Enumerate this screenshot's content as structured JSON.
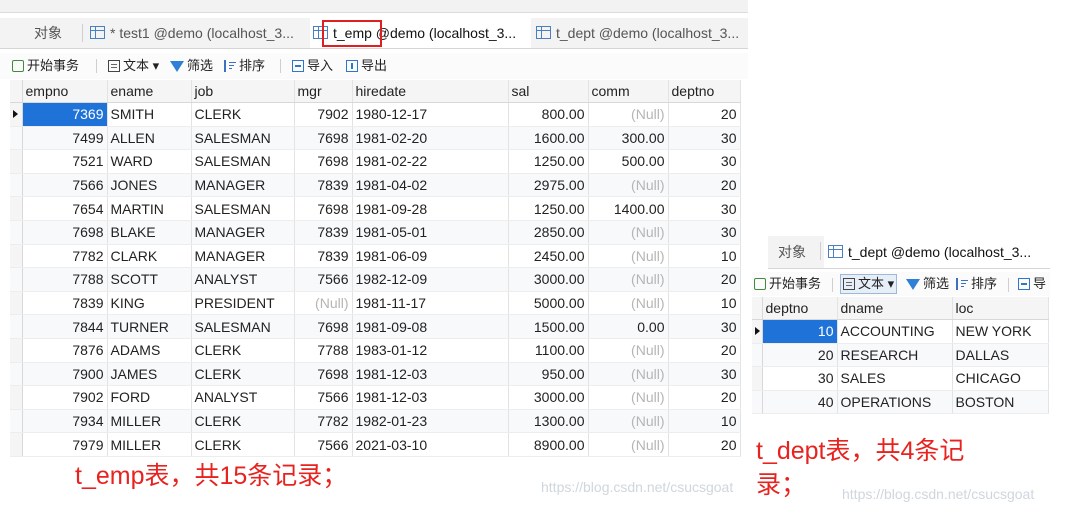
{
  "emp_window": {
    "tabs": [
      {
        "label": "对象"
      },
      {
        "label": "* test1 @demo (localhost_3..."
      },
      {
        "label": "t_emp @demo (localhost_3..."
      },
      {
        "label": "t_dept @demo (localhost_3..."
      }
    ],
    "toolbar": {
      "begin_tx": "开始事务",
      "text": "文本",
      "filter": "筛选",
      "sort": "排序",
      "import": "导入",
      "export": "导出"
    },
    "columns": [
      "empno",
      "ename",
      "job",
      "mgr",
      "hiredate",
      "sal",
      "comm",
      "deptno"
    ],
    "rows": [
      [
        "7369",
        "SMITH",
        "CLERK",
        "7902",
        "1980-12-17",
        "800.00",
        "(Null)",
        "20"
      ],
      [
        "7499",
        "ALLEN",
        "SALESMAN",
        "7698",
        "1981-02-20",
        "1600.00",
        "300.00",
        "30"
      ],
      [
        "7521",
        "WARD",
        "SALESMAN",
        "7698",
        "1981-02-22",
        "1250.00",
        "500.00",
        "30"
      ],
      [
        "7566",
        "JONES",
        "MANAGER",
        "7839",
        "1981-04-02",
        "2975.00",
        "(Null)",
        "20"
      ],
      [
        "7654",
        "MARTIN",
        "SALESMAN",
        "7698",
        "1981-09-28",
        "1250.00",
        "1400.00",
        "30"
      ],
      [
        "7698",
        "BLAKE",
        "MANAGER",
        "7839",
        "1981-05-01",
        "2850.00",
        "(Null)",
        "30"
      ],
      [
        "7782",
        "CLARK",
        "MANAGER",
        "7839",
        "1981-06-09",
        "2450.00",
        "(Null)",
        "10"
      ],
      [
        "7788",
        "SCOTT",
        "ANALYST",
        "7566",
        "1982-12-09",
        "3000.00",
        "(Null)",
        "20"
      ],
      [
        "7839",
        "KING",
        "PRESIDENT",
        "(Null)",
        "1981-11-17",
        "5000.00",
        "(Null)",
        "10"
      ],
      [
        "7844",
        "TURNER",
        "SALESMAN",
        "7698",
        "1981-09-08",
        "1500.00",
        "0.00",
        "30"
      ],
      [
        "7876",
        "ADAMS",
        "CLERK",
        "7788",
        "1983-01-12",
        "1100.00",
        "(Null)",
        "20"
      ],
      [
        "7900",
        "JAMES",
        "CLERK",
        "7698",
        "1981-12-03",
        "950.00",
        "(Null)",
        "30"
      ],
      [
        "7902",
        "FORD",
        "ANALYST",
        "7566",
        "1981-12-03",
        "3000.00",
        "(Null)",
        "20"
      ],
      [
        "7934",
        "MILLER",
        "CLERK",
        "7782",
        "1982-01-23",
        "1300.00",
        "(Null)",
        "10"
      ],
      [
        "7979",
        "MILLER",
        "CLERK",
        "7566",
        "2021-03-10",
        "8900.00",
        "(Null)",
        "20"
      ]
    ],
    "caption": "t_emp表，共15条记录；",
    "watermark": "https://blog.csdn.net/csucsgoat"
  },
  "dept_window": {
    "tabs": [
      {
        "label": "对象"
      },
      {
        "label": "t_dept @demo (localhost_3..."
      }
    ],
    "toolbar": {
      "begin_tx": "开始事务",
      "text": "文本",
      "filter": "筛选",
      "sort": "排序",
      "import": "导"
    },
    "columns": [
      "deptno",
      "dname",
      "loc"
    ],
    "rows": [
      [
        "10",
        "ACCOUNTING",
        "NEW YORK"
      ],
      [
        "20",
        "RESEARCH",
        "DALLAS"
      ],
      [
        "30",
        "SALES",
        "CHICAGO"
      ],
      [
        "40",
        "OPERATIONS",
        "BOSTON"
      ]
    ],
    "caption_line1": "t_dept表，共4条记",
    "caption_line2": "录；",
    "watermark": "https://blog.csdn.net/csucsgoat"
  },
  "colors": {
    "selection": "#1f73d8",
    "caption_red": "#e8231f",
    "highlight_box": "#e02020",
    "null_text": "#b5b5b5"
  }
}
